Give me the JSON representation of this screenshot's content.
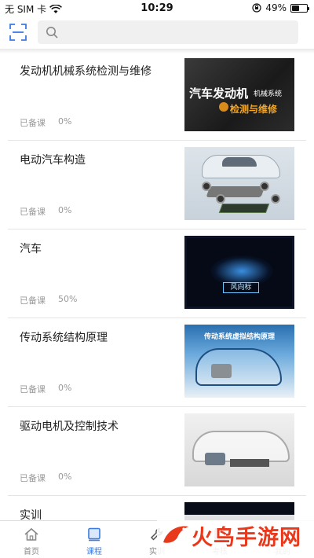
{
  "status_bar": {
    "carrier": "无 SIM 卡",
    "time": "10:29",
    "battery_percent": "49%",
    "battery_level": 0.49
  },
  "search": {
    "placeholder": "",
    "value": ""
  },
  "courses": [
    {
      "title": "发动机机械系统检测与维修",
      "status": "已备课",
      "progress": "0%",
      "thumb": {
        "line1": "汽车发动机",
        "line2": "机械系统",
        "line3": "检测与维修"
      }
    },
    {
      "title": "电动汽车构造",
      "status": "已备课",
      "progress": "0%"
    },
    {
      "title": "汽车",
      "status": "已备课",
      "progress": "50%",
      "thumb": {
        "tag": "风向标"
      }
    },
    {
      "title": "传动系统结构原理",
      "status": "已备课",
      "progress": "0%",
      "thumb": {
        "line1": "传动系统虚拟结构原理"
      }
    },
    {
      "title": "驱动电机及控制技术",
      "status": "已备课",
      "progress": "0%"
    },
    {
      "title": "实训",
      "status": "",
      "progress": ""
    }
  ],
  "tabs": [
    {
      "label": "首页",
      "icon": "home-icon",
      "active": false
    },
    {
      "label": "课程",
      "icon": "book-icon",
      "active": true
    },
    {
      "label": "实训",
      "icon": "wrench-icon",
      "active": false
    },
    {
      "label": "考核",
      "icon": "exam-icon",
      "active": false
    },
    {
      "label": "我的",
      "icon": "user-icon",
      "active": false
    }
  ],
  "watermark": {
    "text": "火鸟手游网"
  },
  "colors": {
    "accent": "#3b7be0",
    "watermark": "#e8391c",
    "meta_text": "#999999"
  }
}
